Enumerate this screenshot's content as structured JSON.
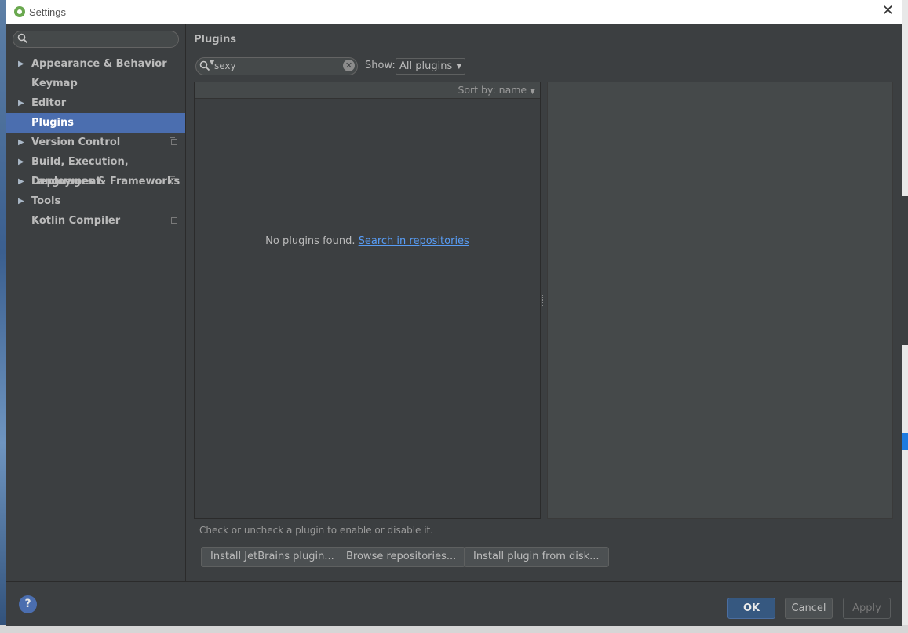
{
  "window": {
    "title": "Settings"
  },
  "sidebar": {
    "search_value": "",
    "items": [
      {
        "label": "Appearance & Behavior",
        "expandable": true,
        "project_icon": false
      },
      {
        "label": "Keymap",
        "expandable": false,
        "project_icon": false
      },
      {
        "label": "Editor",
        "expandable": true,
        "project_icon": false
      },
      {
        "label": "Plugins",
        "expandable": false,
        "project_icon": false,
        "selected": true
      },
      {
        "label": "Version Control",
        "expandable": true,
        "project_icon": true
      },
      {
        "label": "Build, Execution, Deployment",
        "expandable": true,
        "project_icon": false
      },
      {
        "label": "Languages & Frameworks",
        "expandable": true,
        "project_icon": true
      },
      {
        "label": "Tools",
        "expandable": true,
        "project_icon": false
      },
      {
        "label": "Kotlin Compiler",
        "expandable": false,
        "project_icon": true
      }
    ]
  },
  "plugins": {
    "title": "Plugins",
    "search_value": "sexy",
    "show_label": "Show:",
    "show_value": "All plugins",
    "sort_by": "Sort by: name",
    "empty_text": "No plugins found.",
    "empty_link": "Search in repositories",
    "hint": "Check or uncheck a plugin to enable or disable it.",
    "buttons": {
      "install_jetbrains": "Install JetBrains plugin...",
      "browse": "Browse repositories...",
      "install_disk": "Install plugin from disk..."
    }
  },
  "footer": {
    "help": "?",
    "ok": "OK",
    "cancel": "Cancel",
    "apply": "Apply"
  },
  "colors": {
    "selection": "#4b6eaf",
    "link": "#589df6",
    "ok_button": "#365880"
  }
}
